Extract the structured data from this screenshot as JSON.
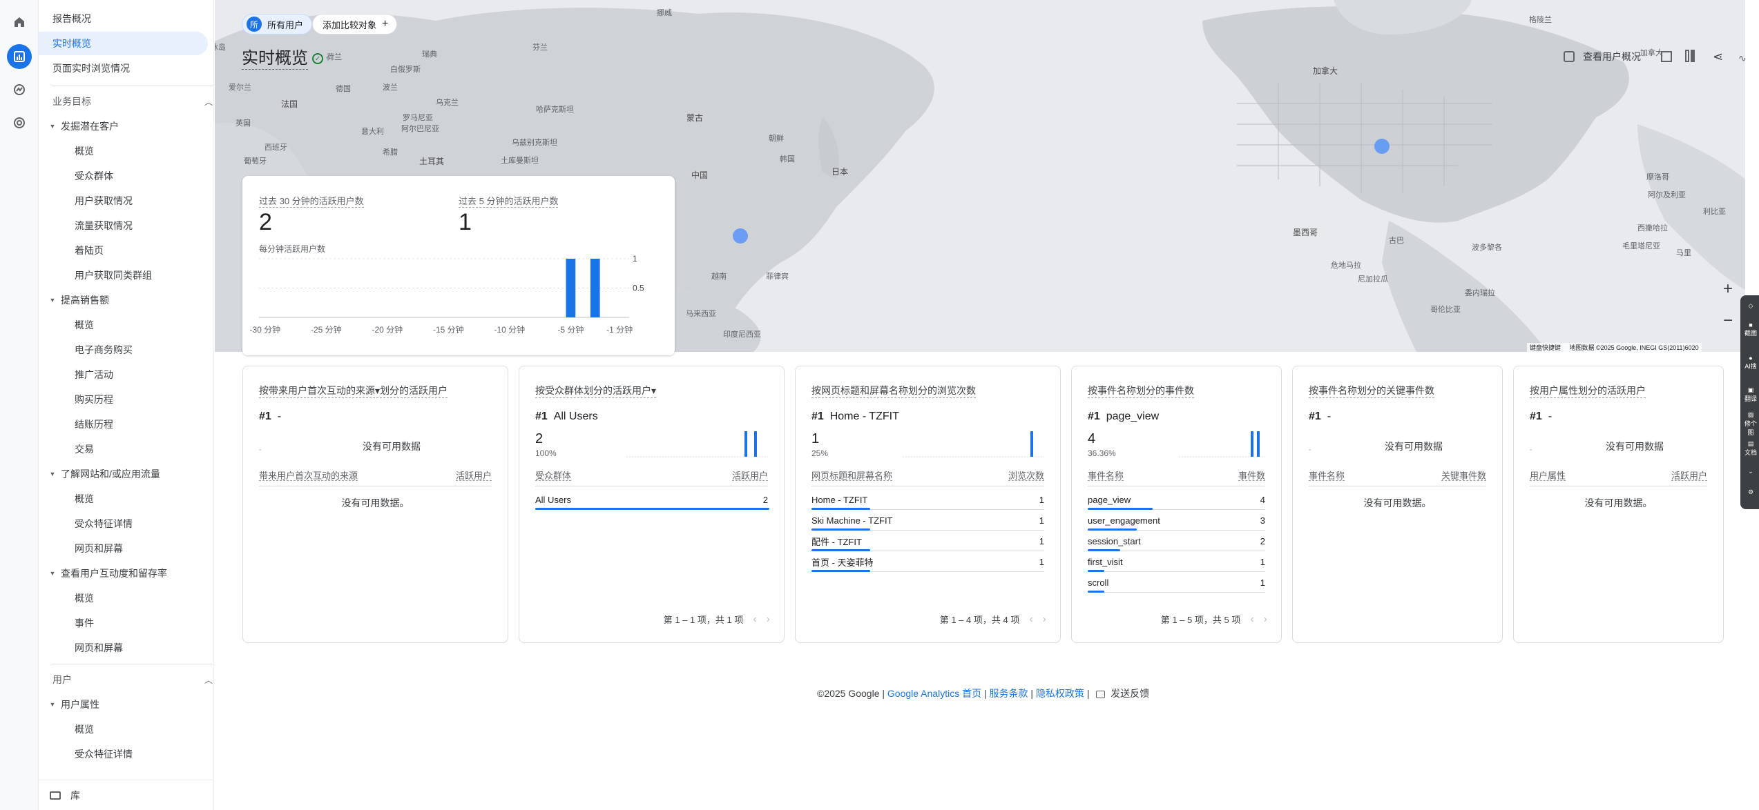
{
  "sidebar": {
    "items": [
      {
        "label": "报告概况"
      },
      {
        "label": "实时概览"
      },
      {
        "label": "页面实时浏览情况"
      }
    ],
    "sections": [
      {
        "label": "业务目标",
        "groups": [
          {
            "label": "发掘潜在客户",
            "items": [
              "概览",
              "受众群体",
              "用户获取情况",
              "流量获取情况",
              "着陆页",
              "用户获取同类群组"
            ]
          },
          {
            "label": "提高销售额",
            "items": [
              "概览",
              "电子商务购买",
              "推广活动",
              "购买历程",
              "结账历程",
              "交易"
            ]
          },
          {
            "label": "了解网站和/或应用流量",
            "items": [
              "概览",
              "受众特征详情",
              "网页和屏幕"
            ]
          },
          {
            "label": "查看用户互动度和留存率",
            "items": [
              "概览",
              "事件",
              "网页和屏幕"
            ]
          }
        ]
      },
      {
        "label": "用户",
        "groups": [
          {
            "label": "用户属性",
            "items": [
              "概览",
              "受众特征详情"
            ]
          }
        ]
      }
    ],
    "library_label": "库"
  },
  "header": {
    "chip_all_users_avatar": "所",
    "chip_all_users": "所有用户",
    "chip_add_compare": "添加比较对象",
    "page_title": "实时概览",
    "view_user_overview": "查看用户概况"
  },
  "summary": {
    "label_30min": "过去 30 分钟的活跃用户数",
    "value_30min": "2",
    "label_5min": "过去 5 分钟的活跃用户数",
    "value_5min": "1",
    "chart_label": "每分钟活跃用户数",
    "y_ticks": [
      "1",
      "0.5"
    ],
    "x_ticks": [
      "-30 分钟",
      "-25 分钟",
      "-20 分钟",
      "-15 分钟",
      "-10 分钟",
      "-5 分钟",
      "-1 分钟"
    ]
  },
  "chart_data": {
    "type": "bar",
    "title": "每分钟活跃用户数",
    "categories": [
      "-30",
      "-29",
      "-28",
      "-27",
      "-26",
      "-25",
      "-24",
      "-23",
      "-22",
      "-21",
      "-20",
      "-19",
      "-18",
      "-17",
      "-16",
      "-15",
      "-14",
      "-13",
      "-12",
      "-11",
      "-10",
      "-9",
      "-8",
      "-7",
      "-6",
      "-5",
      "-4",
      "-3",
      "-2",
      "-1"
    ],
    "values": [
      0,
      0,
      0,
      0,
      0,
      0,
      0,
      0,
      0,
      0,
      0,
      0,
      0,
      0,
      0,
      0,
      0,
      0,
      0,
      0,
      0,
      0,
      0,
      0,
      0,
      1,
      0,
      1,
      0,
      0
    ],
    "ylim": [
      0,
      1
    ],
    "x_tick_labels": [
      "-30 分钟",
      "-25 分钟",
      "-20 分钟",
      "-15 分钟",
      "-10 分钟",
      "-5 分钟",
      "-1 分钟"
    ],
    "y_tick_labels": [
      "1",
      "0.5"
    ],
    "color": "#1a73e8"
  },
  "cards": [
    {
      "title": "按带来用户首次互动的来源▾划分的活跃用户",
      "top_rank": "#1",
      "top_name": "-",
      "no_data_top": "没有可用数据",
      "col1": "带来用户首次互动的来源",
      "col2": "活跃用户",
      "no_data_table": "没有可用数据。",
      "rows": [],
      "pager": ""
    },
    {
      "title": "按受众群体划分的活跃用户▾",
      "top_rank": "#1",
      "top_name": "All Users",
      "top_value": "2",
      "top_pct": "100%",
      "col1": "受众群体",
      "col2": "活跃用户",
      "rows": [
        {
          "name": "All Users",
          "value": "2",
          "share": 1.0
        }
      ],
      "pager": "第 1 – 1 项，共 1 项"
    },
    {
      "title": "按网页标题和屏幕名称划分的浏览次数",
      "top_rank": "#1",
      "top_name": "Home - TZFIT",
      "top_value": "1",
      "top_pct": "25%",
      "col1": "网页标题和屏幕名称",
      "col2": "浏览次数",
      "rows": [
        {
          "name": "Home - TZFIT",
          "value": "1",
          "share": 0.25
        },
        {
          "name": "Ski Machine - TZFIT",
          "value": "1",
          "share": 0.25
        },
        {
          "name": "配件 - TZFIT",
          "value": "1",
          "share": 0.25
        },
        {
          "name": "首页 - 天姿菲特",
          "value": "1",
          "share": 0.25
        }
      ],
      "pager": "第 1 – 4 项，共 4 项"
    },
    {
      "title": "按事件名称划分的事件数",
      "top_rank": "#1",
      "top_name": "page_view",
      "top_value": "4",
      "top_pct": "36.36%",
      "col1": "事件名称",
      "col2": "事件数",
      "rows": [
        {
          "name": "page_view",
          "value": "4",
          "share": 0.3636
        },
        {
          "name": "user_engagement",
          "value": "3",
          "share": 0.2727
        },
        {
          "name": "session_start",
          "value": "2",
          "share": 0.1818
        },
        {
          "name": "first_visit",
          "value": "1",
          "share": 0.0909
        },
        {
          "name": "scroll",
          "value": "1",
          "share": 0.0909
        }
      ],
      "pager": "第 1 – 5 项，共 5 项"
    },
    {
      "title": "按事件名称划分的关键事件数",
      "top_rank": "#1",
      "top_name": "-",
      "no_data_top": "没有可用数据",
      "col1": "事件名称",
      "col2": "关键事件数",
      "no_data_table": "没有可用数据。",
      "rows": [],
      "pager": ""
    },
    {
      "title": "按用户属性划分的活跃用户",
      "top_rank": "#1",
      "top_name": "-",
      "no_data_top": "没有可用数据",
      "col1": "用户属性",
      "col2": "活跃用户",
      "no_data_table": "没有可用数据。",
      "rows": [],
      "pager": ""
    }
  ],
  "footer": {
    "copyright": "©2025 Google |",
    "link_home": "Google Analytics 首页",
    "sep1": "|",
    "link_terms": "服务条款",
    "sep2": "|",
    "link_privacy": "隐私权政策",
    "sep3": "|",
    "feedback": "发送反馈"
  },
  "map": {
    "labels": [
      "挪威",
      "芬兰",
      "冰岛",
      "英国",
      "瑞典",
      "爱尔兰",
      "法国",
      "西班牙",
      "葡萄牙",
      "意大利",
      "德国",
      "波兰",
      "乌克兰",
      "白俄罗斯",
      "罗马尼亚",
      "希腊",
      "土耳其",
      "哈萨克斯坦",
      "乌兹别克斯坦",
      "土库曼斯坦",
      "蒙古",
      "中国",
      "日本",
      "韩国",
      "朝鲜",
      "越南",
      "菲律宾",
      "马来西亚",
      "印度尼西亚",
      "墨西哥",
      "古巴",
      "危地马拉",
      "尼加拉瓜",
      "委内瑞拉",
      "哥伦比亚",
      "阿尔及利亚",
      "利比亚",
      "摩洛哥",
      "西撒哈拉",
      "毛里塔尼亚",
      "马里",
      "加拿大",
      "格陵兰",
      "加拿大",
      "波多黎各",
      "荷兰",
      "阿尔巴尼亚"
    ],
    "attribution": "地图数据 ©2025 Google, INEGI GS(2011)6020",
    "shortcuts": "键盘快捷键",
    "zoom_in": "+",
    "zoom_out": "−"
  },
  "right_tools": {
    "labels": [
      "截图",
      "AI搜",
      "翻译",
      "修个图",
      "文档"
    ]
  }
}
